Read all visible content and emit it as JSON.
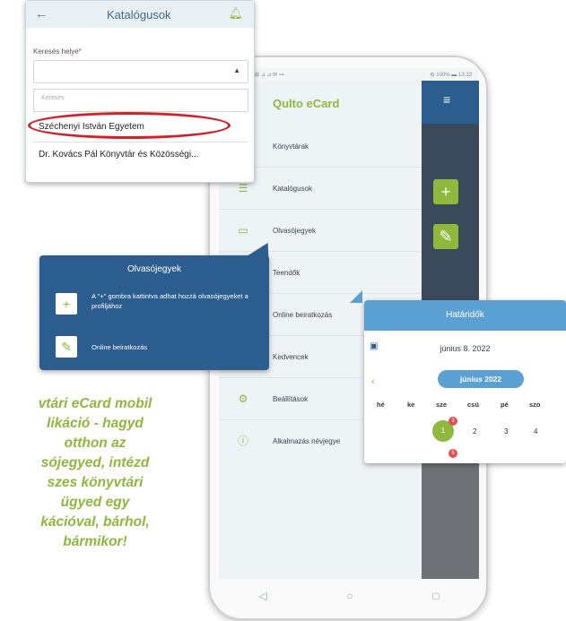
{
  "phone": {
    "status_left": "⊞ ⊿ ⊿ ✉ ⊶",
    "status_right": "⚙ 100% ▬ 13:33",
    "app_title": "Qulto eCard",
    "drawer_items": [
      {
        "label": "Könyvtárak",
        "icon": "library-icon"
      },
      {
        "label": "Katalógusok",
        "icon": "list-icon"
      },
      {
        "label": "Olvasójegyek",
        "icon": "card-icon"
      },
      {
        "label": "Teendők",
        "icon": "task-icon"
      },
      {
        "label": "Online beiratkozás",
        "icon": "enroll-icon"
      },
      {
        "label": "Kedvencek",
        "icon": "star-icon"
      },
      {
        "label": "Beállítások",
        "icon": "gear-icon"
      },
      {
        "label": "Alkalmazás névjegye",
        "icon": "info-icon"
      }
    ],
    "nav": {
      "back": "◁",
      "home": "○",
      "recent": "□"
    }
  },
  "catalog_popup": {
    "title": "Katalógusok",
    "field_label": "Keresés helye",
    "required_mark": "*",
    "search_placeholder": "Keresés",
    "options": [
      "Széchenyi István Egyetem",
      "Dr. Kovács Pál Könyvtár és Közösségi..."
    ]
  },
  "card_popup": {
    "title": "Olvasójegyek",
    "add_text": "A \"+\" gombra kattintva adhat hozzá olvasójegyeket a profiljához",
    "online_text": "Online beiratkozás"
  },
  "deadline_popup": {
    "title": "Határidők",
    "date": "június 8. 2022",
    "month": "június 2022",
    "weekdays": [
      "hé",
      "ke",
      "sze",
      "csü",
      "pé",
      "szo"
    ],
    "days": [
      "1",
      "2",
      "3",
      "4"
    ],
    "badge_count": "3",
    "badge_count_2": "5"
  },
  "promo_text": "vtári eCard mobil\nlikáció - hagyd\notthon az\nsójegyed, intézd\nszes könyvtári\nügyed egy\nkációval, bárhol,\nbármikor!",
  "colors": {
    "brand_green": "#8fb83c",
    "brand_blue": "#2c5d8f",
    "accent_red": "#d32027"
  }
}
